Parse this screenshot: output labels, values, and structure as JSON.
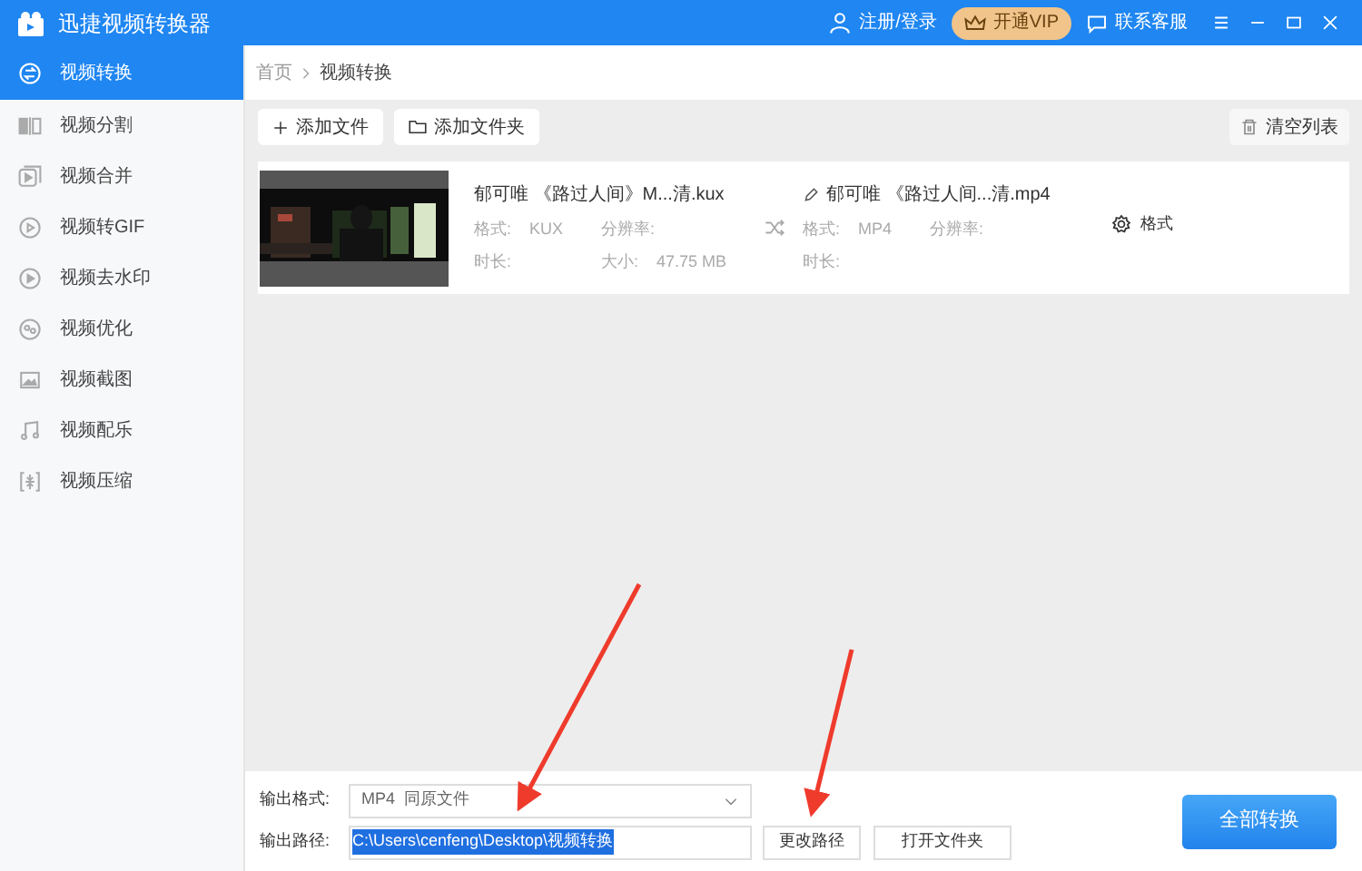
{
  "app": {
    "title": "迅捷视频转换器"
  },
  "header_actions": [
    {
      "kind": "user",
      "label": "注册/登录"
    },
    {
      "kind": "vip",
      "label": "开通VIP"
    },
    {
      "kind": "support",
      "label": "联系客服"
    }
  ],
  "sidebar": {
    "items": [
      {
        "kind": "convert",
        "label": "视频转换",
        "selected": true
      },
      {
        "kind": "split",
        "label": "视频分割",
        "selected": false
      },
      {
        "kind": "merge",
        "label": "视频合并",
        "selected": false
      },
      {
        "kind": "gif",
        "label": "视频转GIF",
        "selected": false
      },
      {
        "kind": "watermark",
        "label": "视频去水印",
        "selected": false
      },
      {
        "kind": "optimize",
        "label": "视频优化",
        "selected": false
      },
      {
        "kind": "capture",
        "label": "视频截图",
        "selected": false
      },
      {
        "kind": "music",
        "label": "视频配乐",
        "selected": false
      },
      {
        "kind": "compress",
        "label": "视频压缩",
        "selected": false
      }
    ]
  },
  "breadcrumb": [
    "首页",
    "视频转换"
  ],
  "toolbar": {
    "buttons": [
      {
        "kind": "add",
        "label": "添加文件"
      },
      {
        "kind": "folder",
        "label": "添加文件夹"
      }
    ],
    "clear_label": "清空列表"
  },
  "files": [
    {
      "source": {
        "name": "郁可唯 《路过人间》M...清.kux",
        "format_label": "格式:",
        "format": "KUX",
        "resolution_label": "分辨率:",
        "duration_label": "时长:",
        "size_label": "大小:",
        "size": "47.75 MB"
      },
      "output": {
        "name": "郁可唯 《路过人间...清.mp4",
        "format_label": "格式:",
        "format": "MP4",
        "resolution_label": "分辨率:",
        "duration_label": "时长:"
      },
      "settings_label": "格式"
    }
  ],
  "output": {
    "format_label": "输出格式:",
    "format_value": "MP4  同原文件",
    "path_label": "输出路径:",
    "path_value": "C:\\Users\\cenfeng\\Desktop\\视频转换",
    "path_selected": true,
    "change_button": "更改路径",
    "open_button": "打开文件夹",
    "convert_button": "全部转换"
  }
}
